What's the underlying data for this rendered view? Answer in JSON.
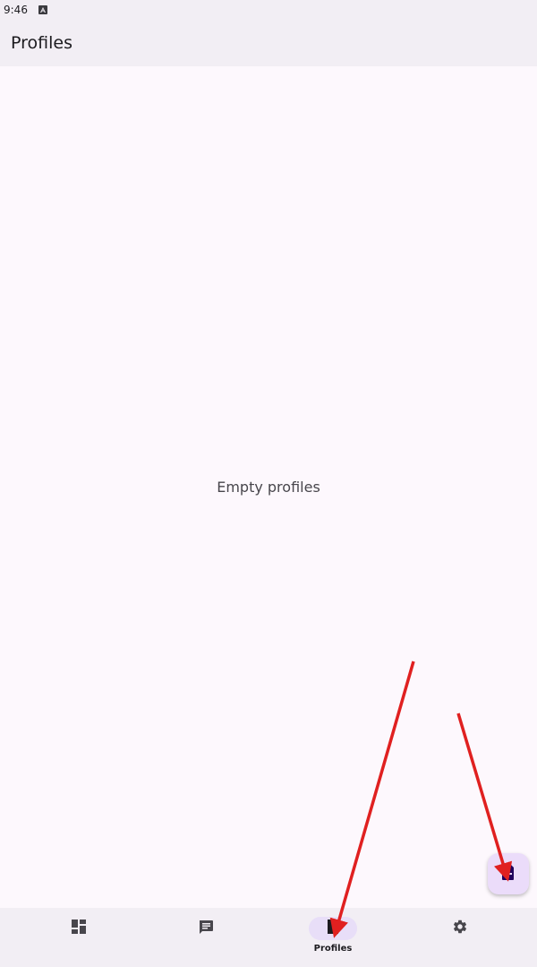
{
  "status_bar": {
    "time": "9:46",
    "icon": "a-notification-icon"
  },
  "app_bar": {
    "title": "Profiles"
  },
  "content": {
    "empty_message": "Empty profiles"
  },
  "fab": {
    "icon": "add-file-icon"
  },
  "nav": {
    "items": [
      {
        "icon": "dashboard-icon",
        "label": ""
      },
      {
        "icon": "message-icon",
        "label": ""
      },
      {
        "icon": "file-icon",
        "label": "Profiles",
        "active": true
      },
      {
        "icon": "gear-icon",
        "label": ""
      }
    ]
  },
  "colors": {
    "accent": "#e8def8",
    "background": "#fdf8fd",
    "bar": "#f2eef4",
    "annotation": "#e02020"
  }
}
